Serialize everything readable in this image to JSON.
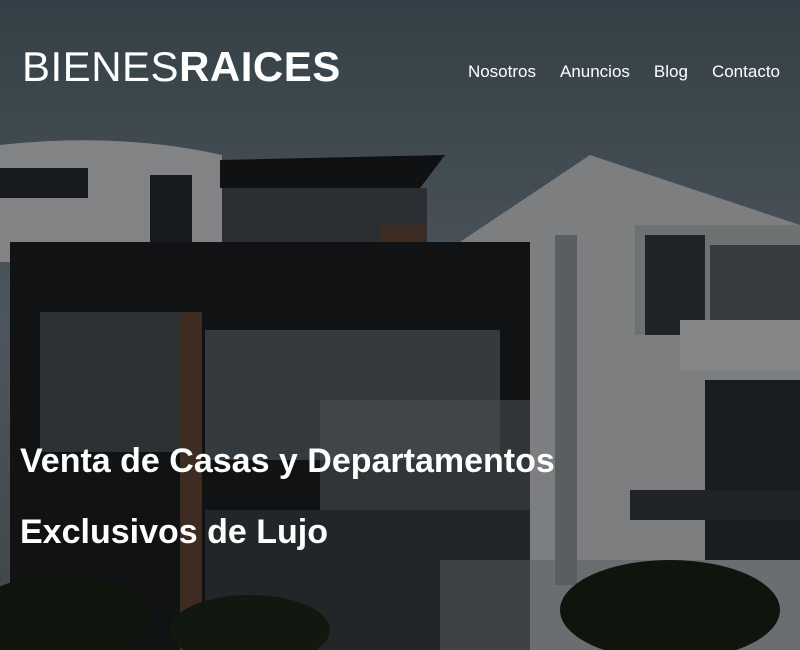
{
  "brand": {
    "name_light": "BIENES",
    "name_bold": "RAICES"
  },
  "nav": {
    "items": [
      {
        "label": "Nosotros"
      },
      {
        "label": "Anuncios"
      },
      {
        "label": "Blog"
      },
      {
        "label": "Contacto"
      }
    ]
  },
  "hero": {
    "title_line1": "Venta de Casas y Departamentos",
    "title_line2": "Exclusivos de Lujo"
  },
  "colors": {
    "text": "#ffffff",
    "overlay": "#000000"
  }
}
